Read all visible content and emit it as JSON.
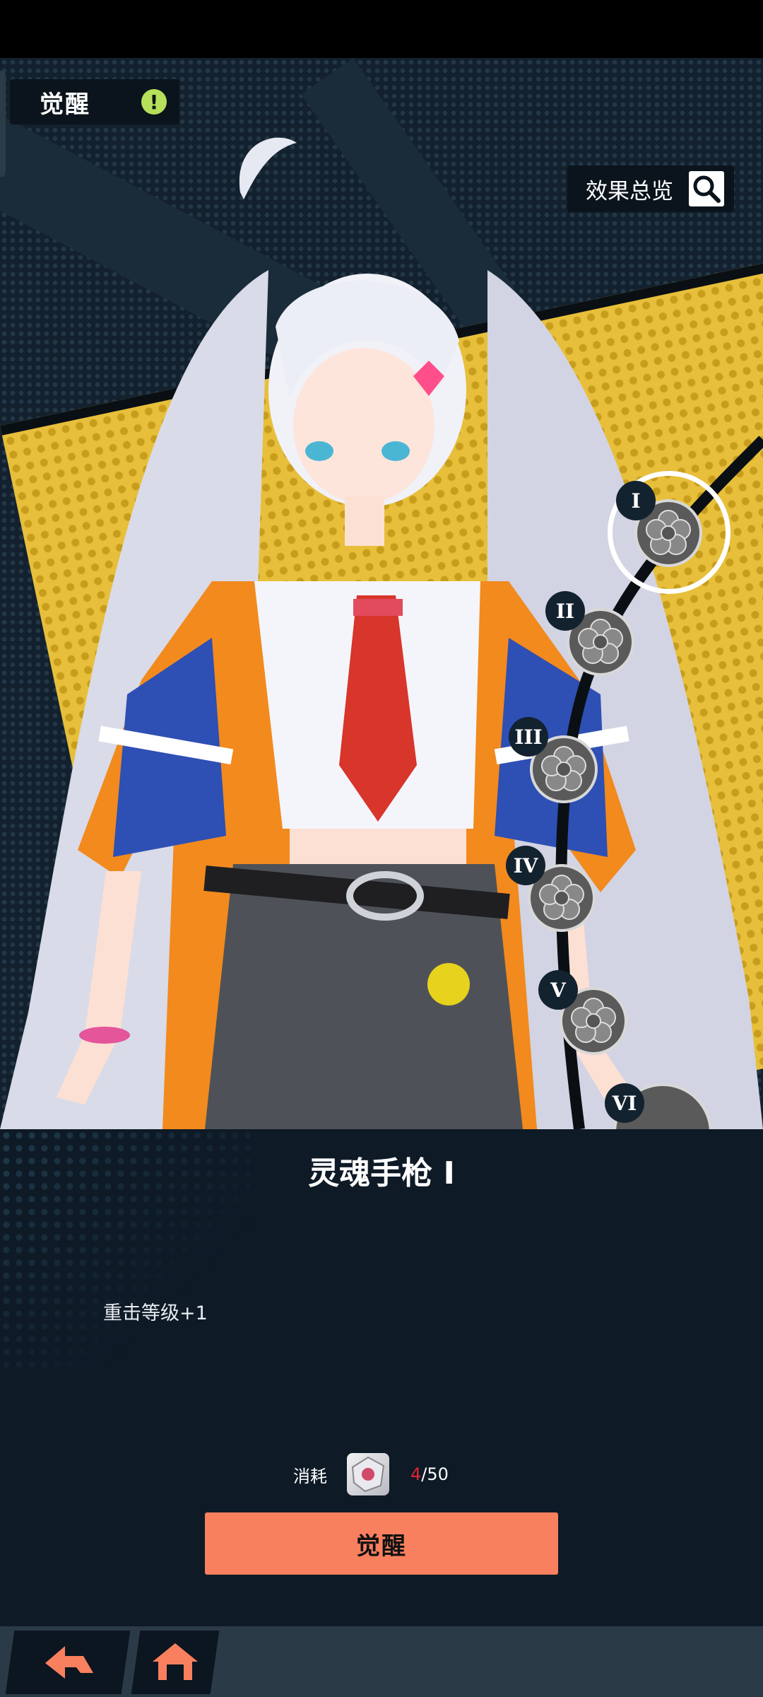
{
  "header": {
    "tab_label": "觉醒",
    "alert_icon": "!"
  },
  "overview": {
    "label": "效果总览",
    "icon": "magnifier-icon"
  },
  "nodes": [
    {
      "numeral": "I",
      "selected": true
    },
    {
      "numeral": "II",
      "selected": false
    },
    {
      "numeral": "III",
      "selected": false
    },
    {
      "numeral": "IV",
      "selected": false
    },
    {
      "numeral": "V",
      "selected": false
    },
    {
      "numeral": "VI",
      "selected": false
    }
  ],
  "skill": {
    "title": "灵魂手枪 I",
    "description": "重击等级+1"
  },
  "cost": {
    "label": "消耗",
    "have": "4",
    "need": "/50"
  },
  "action": {
    "awaken_label": "觉醒"
  },
  "nav": {
    "back_icon": "back-arrow-icon",
    "home_icon": "home-icon"
  },
  "colors": {
    "accent": "#f9805e",
    "alert": "#b7e05a",
    "panel": "#0e1a26",
    "yellow": "#e7bf3b"
  }
}
